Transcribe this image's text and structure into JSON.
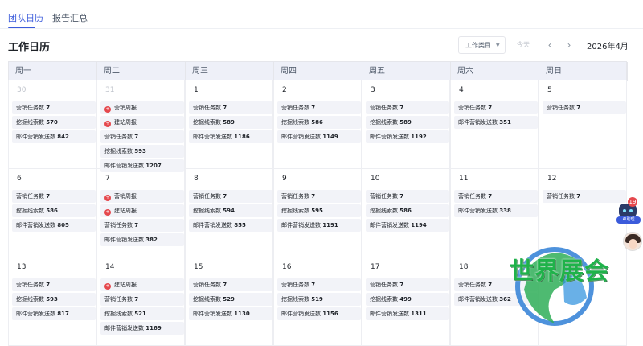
{
  "tabs": [
    {
      "label": "团队日历",
      "active": true
    },
    {
      "label": "报告汇总",
      "active": false
    }
  ],
  "page_title": "工作日历",
  "toolbar": {
    "type_select": "工作类目",
    "today": "今天",
    "prev": "‹",
    "next": "›",
    "month": "2026年4月"
  },
  "weekdays": [
    "周一",
    "周二",
    "周三",
    "周四",
    "周五",
    "周六",
    "周日"
  ],
  "weeks": [
    [
      {
        "date": "30",
        "muted": true,
        "events": [
          {
            "label": "营销任务数",
            "value": "7"
          },
          {
            "label": "挖掘线索数",
            "value": "570"
          },
          {
            "label": "邮件营销发送数",
            "value": "842"
          }
        ]
      },
      {
        "date": "31",
        "muted": true,
        "events": [
          {
            "label": "营销周报",
            "value": "",
            "badge": true
          },
          {
            "label": "建站周报",
            "value": "",
            "badge": true
          },
          {
            "label": "营销任务数",
            "value": "7"
          },
          {
            "label": "挖掘线索数",
            "value": "593"
          },
          {
            "label": "邮件营销发送数",
            "value": "1207"
          }
        ]
      },
      {
        "date": "1",
        "events": [
          {
            "label": "营销任务数",
            "value": "7"
          },
          {
            "label": "挖掘线索数",
            "value": "589"
          },
          {
            "label": "邮件营销发送数",
            "value": "1186"
          }
        ]
      },
      {
        "date": "2",
        "events": [
          {
            "label": "营销任务数",
            "value": "7"
          },
          {
            "label": "挖掘线索数",
            "value": "586"
          },
          {
            "label": "邮件营销发送数",
            "value": "1149"
          }
        ]
      },
      {
        "date": "3",
        "events": [
          {
            "label": "营销任务数",
            "value": "7"
          },
          {
            "label": "挖掘线索数",
            "value": "589"
          },
          {
            "label": "邮件营销发送数",
            "value": "1192"
          }
        ]
      },
      {
        "date": "4",
        "events": [
          {
            "label": "营销任务数",
            "value": "7"
          },
          {
            "label": "邮件营销发送数",
            "value": "351"
          }
        ]
      },
      {
        "date": "5",
        "events": [
          {
            "label": "营销任务数",
            "value": "7"
          }
        ]
      }
    ],
    [
      {
        "date": "6",
        "events": [
          {
            "label": "营销任务数",
            "value": "7"
          },
          {
            "label": "挖掘线索数",
            "value": "586"
          },
          {
            "label": "邮件营销发送数",
            "value": "805"
          }
        ]
      },
      {
        "date": "7",
        "events": [
          {
            "label": "营销周报",
            "value": "",
            "badge": true
          },
          {
            "label": "建站周报",
            "value": "",
            "badge": true
          },
          {
            "label": "营销任务数",
            "value": "7"
          },
          {
            "label": "邮件营销发送数",
            "value": "382"
          }
        ]
      },
      {
        "date": "8",
        "events": [
          {
            "label": "营销任务数",
            "value": "7"
          },
          {
            "label": "挖掘线索数",
            "value": "594"
          },
          {
            "label": "邮件营销发送数",
            "value": "855"
          }
        ]
      },
      {
        "date": "9",
        "events": [
          {
            "label": "营销任务数",
            "value": "7"
          },
          {
            "label": "挖掘线索数",
            "value": "595"
          },
          {
            "label": "邮件营销发送数",
            "value": "1191"
          }
        ]
      },
      {
        "date": "10",
        "events": [
          {
            "label": "营销任务数",
            "value": "7"
          },
          {
            "label": "挖掘线索数",
            "value": "586"
          },
          {
            "label": "邮件营销发送数",
            "value": "1194"
          }
        ]
      },
      {
        "date": "11",
        "events": [
          {
            "label": "营销任务数",
            "value": "7"
          },
          {
            "label": "邮件营销发送数",
            "value": "338"
          }
        ]
      },
      {
        "date": "12",
        "events": [
          {
            "label": "营销任务数",
            "value": "7"
          }
        ]
      }
    ],
    [
      {
        "date": "13",
        "events": [
          {
            "label": "营销任务数",
            "value": "7"
          },
          {
            "label": "挖掘线索数",
            "value": "593"
          },
          {
            "label": "邮件营销发送数",
            "value": "817"
          }
        ]
      },
      {
        "date": "14",
        "events": [
          {
            "label": "建站周报",
            "value": "",
            "badge": true
          },
          {
            "label": "营销任务数",
            "value": "7"
          },
          {
            "label": "挖掘线索数",
            "value": "521"
          },
          {
            "label": "邮件营销发送数",
            "value": "1169"
          }
        ]
      },
      {
        "date": "15",
        "events": [
          {
            "label": "营销任务数",
            "value": "7"
          },
          {
            "label": "挖掘线索数",
            "value": "529"
          },
          {
            "label": "邮件营销发送数",
            "value": "1130"
          }
        ]
      },
      {
        "date": "16",
        "events": [
          {
            "label": "营销任务数",
            "value": "7"
          },
          {
            "label": "挖掘线索数",
            "value": "519"
          },
          {
            "label": "邮件营销发送数",
            "value": "1156"
          }
        ]
      },
      {
        "date": "17",
        "events": [
          {
            "label": "营销任务数",
            "value": "7"
          },
          {
            "label": "挖掘线索数",
            "value": "499"
          },
          {
            "label": "邮件营销发送数",
            "value": "1311"
          }
        ]
      },
      {
        "date": "18",
        "events": [
          {
            "label": "营销任务数",
            "value": "7"
          },
          {
            "label": "邮件营销发送数",
            "value": "362"
          }
        ]
      },
      {
        "date": "",
        "events": []
      }
    ]
  ],
  "floating": {
    "badge_count": "19",
    "bot_label": "AI助理"
  },
  "watermark": "世界展会",
  "colors": {
    "accent": "#3b5bdb",
    "badge": "#e5484d",
    "event_bg": "#f2f3f8",
    "watermark": "#1fb24a"
  }
}
